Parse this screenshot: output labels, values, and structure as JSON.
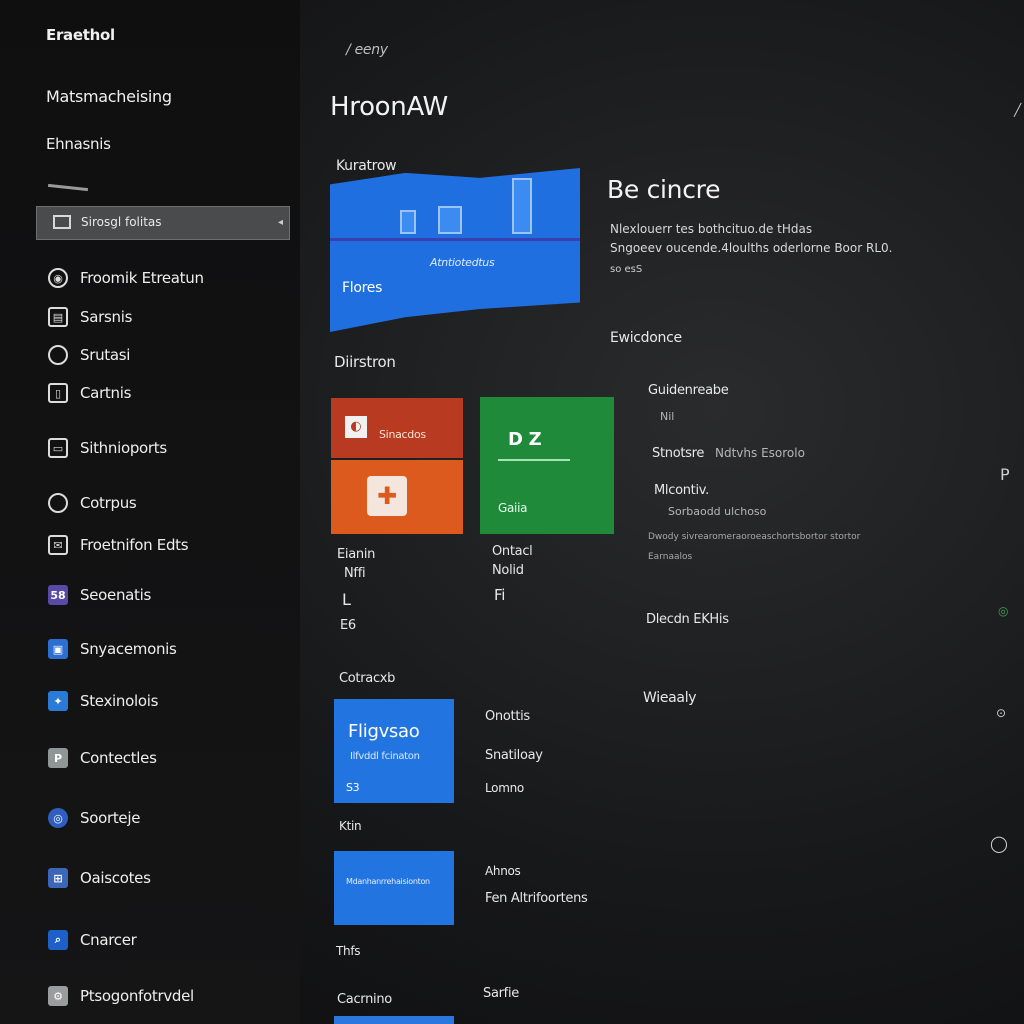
{
  "sidebar": {
    "app_title": "Eraethol",
    "subtitle": "Matsmacheising",
    "section": "Ehnasnis",
    "search": {
      "text": "Sirosgl folitas"
    },
    "items": [
      {
        "label": "Froomik Etreatun",
        "icon": "settings-icon"
      },
      {
        "label": "Sarsnis",
        "icon": "folder-icon"
      },
      {
        "label": "Srutasi",
        "icon": "search-icon"
      },
      {
        "label": "Cartnis",
        "icon": "document-icon"
      },
      {
        "label": "Sithnioports",
        "icon": "monitor-icon"
      },
      {
        "label": "Cotrpus",
        "icon": "chat-icon"
      },
      {
        "label": "Froetnifon Edts",
        "icon": "mail-icon"
      },
      {
        "label": "Seoenatis",
        "icon": "app-purple-icon"
      },
      {
        "label": "Snyacemonis",
        "icon": "app-blue-icon"
      },
      {
        "label": "Stexinolois",
        "icon": "app-puzzle-icon"
      },
      {
        "label": "Contectles",
        "icon": "app-photo-icon"
      },
      {
        "label": "Soorteje",
        "icon": "app-target-icon"
      },
      {
        "label": "Oaiscotes",
        "icon": "app-grid-icon"
      },
      {
        "label": "Cnarcer",
        "icon": "app-search-icon"
      },
      {
        "label": "Ptsogonfotrvdel",
        "icon": "app-gear-icon"
      }
    ]
  },
  "header": {
    "breadcrumb": "/ eeny",
    "title": "HroonAW"
  },
  "hero": {
    "section_label": "Kuratrow",
    "caption": "Atntiotedtus",
    "label": "Flores"
  },
  "section2": {
    "title": "Diirstron",
    "tile1": {
      "label": "Sinacdos"
    },
    "tile2": {
      "label": "Gaiia"
    },
    "caption1": [
      "Eianin",
      "Nffi",
      "L",
      "E6"
    ],
    "caption2": [
      "Ontacl",
      "Nolid",
      "Fi"
    ]
  },
  "section3": {
    "title": "Cotracxb",
    "tile_a": {
      "title": "Fligvsao",
      "subtitle": "Ilfvddl fcinaton",
      "foot": "S3"
    },
    "tile_b": {
      "text": "Mdanhanrrehaisionton"
    },
    "list_a": [
      "Onottis",
      "Snatiloay",
      "Lomno"
    ],
    "caption_between": "Ktin",
    "list_b": [
      "Ahnos",
      "Fen Altrifoortens"
    ],
    "bottom_left_caption": "Thfs",
    "bottom_left": "Cacrnino",
    "bottom_right": "Sarfie"
  },
  "detail": {
    "title": "Be cincre",
    "desc1": "Nlexlouerr tes bothcituo.de tHdas",
    "desc2": "Sngoeev oucende.4loulths oderlorne Boor RL0.",
    "desc3": "so esS",
    "section": "Ewicdonce",
    "sub1": "Guidenreabe",
    "sub1_small": "Nil",
    "sub2": "Stnotsre",
    "sub2_detail": "Ndtvhs Esorolo",
    "sub3": "Mlcontiv.",
    "sub3_detail": "Sorbaodd ulchoso",
    "fine_print": "Dwody sivrearomeraoroeaschortsbortor stortor",
    "fine_print2": "Earnaalos",
    "section2": "Dlecdn EKHis",
    "section3": "Wieaaly"
  },
  "colors": {
    "accent_blue": "#1f6fe0",
    "tile_red": "#b83a20",
    "tile_orange": "#dd5a1e",
    "tile_green": "#1f8a3a"
  }
}
